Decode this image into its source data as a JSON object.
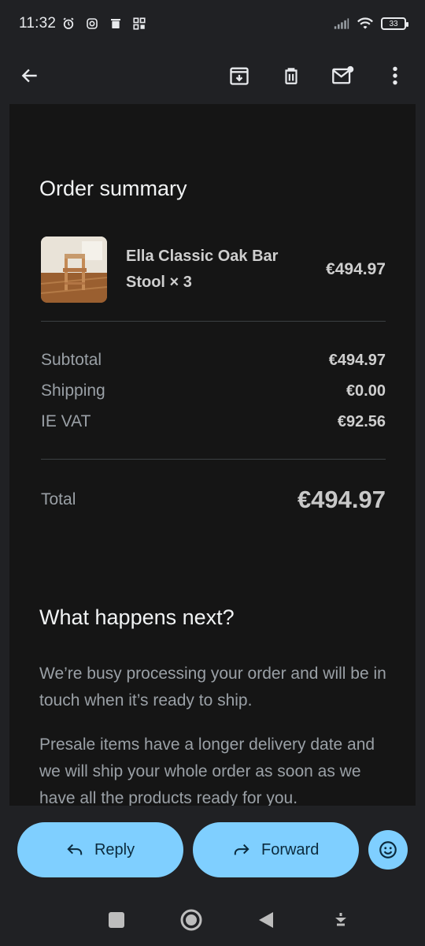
{
  "status_bar": {
    "time": "11:32",
    "battery": "33"
  },
  "app_bar": {
    "icons": [
      "back-arrow-icon",
      "archive-icon",
      "delete-icon",
      "mark-unread-icon",
      "more-options-icon"
    ]
  },
  "order_summary": {
    "title": "Order summary",
    "item": {
      "name": "Ella Classic Oak Bar Stool × 3",
      "price": "€494.97"
    },
    "rows": [
      {
        "label": "Subtotal",
        "value": "€494.97"
      },
      {
        "label": "Shipping",
        "value": "€0.00"
      },
      {
        "label": "IE VAT",
        "value": "€92.56"
      }
    ],
    "total_label": "Total",
    "total_value": "€494.97"
  },
  "next_steps": {
    "title": "What happens next?",
    "para1": "We’re busy processing your order and will be in touch when it’s ready to ship.",
    "para2": "Presale items have a longer delivery date and we will ship your whole order as soon as we have all the products ready for you."
  },
  "actions": {
    "reply_label": "Reply",
    "forward_label": "Forward"
  },
  "colors": {
    "accent": "#7fcfff",
    "background": "#202124",
    "email_bg": "#151515"
  }
}
